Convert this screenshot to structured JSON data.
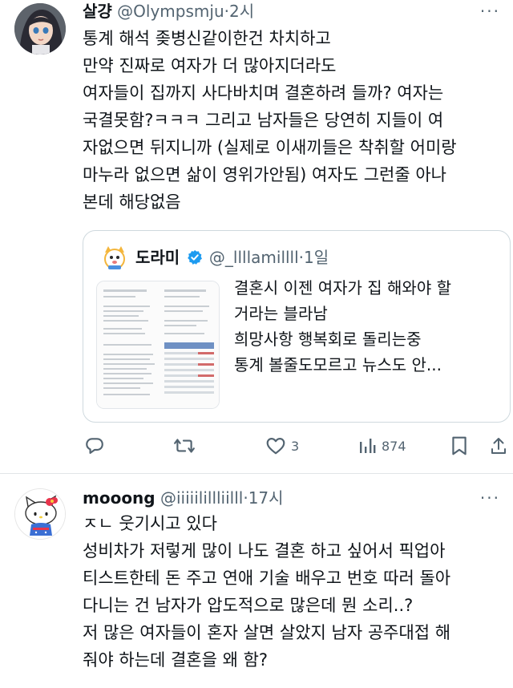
{
  "tweet1": {
    "author_name": "살걍",
    "author_handle": "@Olympsmju",
    "time": "2시",
    "more": "···",
    "body_lines": [
      "통계 해석 좆병신같이한건 차치하고",
      "만약 진짜로 여자가 더 많아지더라도",
      "여자들이 집까지 사다바치며 결혼하려 들까? 여자는",
      "국결못함?ㅋㅋㅋ 그리고 남자들은 당연히 지들이 여",
      "자없으면 뒤지니까 (실제로 이새끼들은 착취할 어미랑",
      "마누라 없으면 삶이 영위가안됨) 여자도 그런줄 아나",
      "본데 해당없음"
    ],
    "quote": {
      "author_name": "도라미",
      "author_handle": "@_llllamillll",
      "time": "1일",
      "text_lines": [
        "결혼시 이젠 여자가 집 해와야 할",
        "거라는 블라남",
        "희망사항 행복회로 돌리는중",
        "통계 볼줄도모르고 뉴스도 안..."
      ]
    },
    "actions": {
      "reply_count": "",
      "retweet_count": "",
      "like_count": "3",
      "view_count": "874"
    }
  },
  "tweet2": {
    "author_name": "mooong",
    "author_handle": "@iiiiilillliilll",
    "time": "17시",
    "more": "···",
    "body_lines": [
      "ㅈㄴ 웃기시고 있다",
      "성비차가 저렇게 많이 나도 결혼 하고 싶어서 픽업아",
      "티스트한테 돈 주고 연애 기술 배우고 번호 따러 돌아",
      "다니는 건 남자가 압도적으로 많은데 뭔 소리..?",
      "저 많은 여자들이 혼자 살면 살았지 남자 공주대접 해",
      "줘야 하는데 결혼을 왜 함?"
    ]
  },
  "colors": {
    "text": "#0f1419",
    "secondary": "#536471",
    "verified": "#1d9bf0",
    "border": "#cfd9de"
  }
}
